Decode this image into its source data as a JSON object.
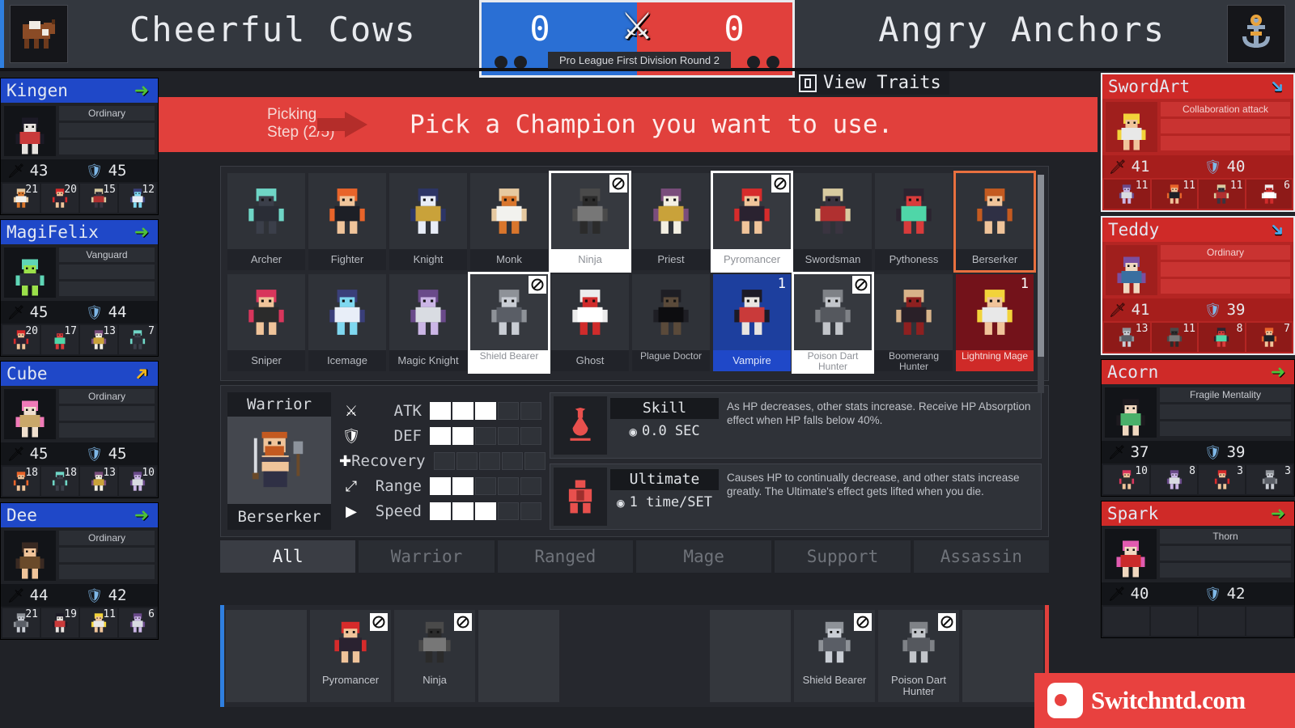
{
  "header": {
    "left_team": {
      "name": "Cheerful Cows",
      "logo_icon": "cow-logo",
      "score": "0",
      "dots": 2
    },
    "right_team": {
      "name": "Angry Anchors",
      "logo_icon": "anchor-logo",
      "score": "0",
      "dots": 2
    },
    "versus_icon": "crossed-swords-icon",
    "round_label": "Pro League First Division Round 2",
    "view_traits": {
      "key": "D",
      "label": "View Traits"
    }
  },
  "banner": {
    "step_line1": "Picking",
    "step_line2": "Step (2/5)",
    "message": "Pick a Champion you want to use.",
    "arrow_icon": "right-arrow-icon",
    "color": "#e1403c"
  },
  "left_players": [
    {
      "name": "Kingen",
      "ready_icon": "green-arrow-right",
      "trait": "Ordinary",
      "atk": "43",
      "def": "45",
      "portrait": "vampire-sprite",
      "picks": [
        {
          "count": "21",
          "icon": "monk-sprite"
        },
        {
          "count": "20",
          "icon": "pyromancer-sprite"
        },
        {
          "count": "15",
          "icon": "swordsman-sprite"
        },
        {
          "count": "12",
          "icon": "icemage-sprite"
        }
      ]
    },
    {
      "name": "MagiFelix",
      "ready_icon": "green-arrow-right",
      "trait": "Vanguard",
      "atk": "45",
      "def": "44",
      "portrait": "greenhair-sprite",
      "picks": [
        {
          "count": "20",
          "icon": "pyromancer-sprite"
        },
        {
          "count": "17",
          "icon": "pythoness-sprite"
        },
        {
          "count": "13",
          "icon": "priest-sprite"
        },
        {
          "count": "7",
          "icon": "archer-sprite"
        }
      ]
    },
    {
      "name": "Cube",
      "ready_icon": "yellow-arrow-upright",
      "trait": "Ordinary",
      "atk": "45",
      "def": "45",
      "portrait": "pinkhair-sprite",
      "picks": [
        {
          "count": "18",
          "icon": "fighter-sprite"
        },
        {
          "count": "18",
          "icon": "archer-sprite"
        },
        {
          "count": "13",
          "icon": "priest-sprite"
        },
        {
          "count": "10",
          "icon": "magicknight-sprite"
        }
      ]
    },
    {
      "name": "Dee",
      "ready_icon": "green-arrow-right",
      "trait": "Ordinary",
      "atk": "44",
      "def": "42",
      "portrait": "brownhair-sprite",
      "picks": [
        {
          "count": "21",
          "icon": "shieldbearer-sprite"
        },
        {
          "count": "19",
          "icon": "vampire-sprite"
        },
        {
          "count": "11",
          "icon": "lightningmage-sprite"
        },
        {
          "count": "6",
          "icon": "magicknight-sprite"
        }
      ]
    }
  ],
  "right_players": [
    {
      "name": "SwordArt",
      "ready_icon": "blue-arrow-downright",
      "trait": "Collaboration attack",
      "atk": "41",
      "def": "40",
      "portrait": "lightningmage-sprite",
      "selected": true,
      "picks": [
        {
          "count": "11",
          "icon": "magicknight-sprite"
        },
        {
          "count": "11",
          "icon": "fighter-sprite"
        },
        {
          "count": "11",
          "icon": "swordsman-sprite"
        },
        {
          "count": "6",
          "icon": "ghost-sprite"
        }
      ]
    },
    {
      "name": "Teddy",
      "ready_icon": "blue-arrow-downright",
      "trait": "Ordinary",
      "atk": "41",
      "def": "39",
      "portrait": "purplehair-sprite",
      "selected": true,
      "picks": [
        {
          "count": "13",
          "icon": "shieldbearer-sprite"
        },
        {
          "count": "11",
          "icon": "ninja-sprite"
        },
        {
          "count": "8",
          "icon": "pythoness-sprite"
        },
        {
          "count": "7",
          "icon": "fighter-sprite"
        }
      ]
    },
    {
      "name": "Acorn",
      "ready_icon": "green-arrow-right",
      "trait": "Fragile Mentality",
      "atk": "37",
      "def": "39",
      "portrait": "blackhair-sprite",
      "selected": false,
      "picks": [
        {
          "count": "10",
          "icon": "sniper-sprite"
        },
        {
          "count": "8",
          "icon": "magicknight-sprite"
        },
        {
          "count": "3",
          "icon": "pyromancer-sprite"
        },
        {
          "count": "3",
          "icon": "shieldbearer-sprite"
        }
      ]
    },
    {
      "name": "Spark",
      "ready_icon": "green-arrow-right",
      "trait": "Thorn",
      "atk": "40",
      "def": "42",
      "portrait": "sparkgirl-sprite",
      "selected": false,
      "picks": [
        {
          "count": "",
          "icon": ""
        },
        {
          "count": "",
          "icon": ""
        },
        {
          "count": "",
          "icon": ""
        },
        {
          "count": "",
          "icon": ""
        }
      ]
    }
  ],
  "champion_grid": {
    "row1": [
      {
        "name": "Archer",
        "state": "normal",
        "icon": "archer-sprite"
      },
      {
        "name": "Fighter",
        "state": "normal",
        "icon": "fighter-sprite"
      },
      {
        "name": "Knight",
        "state": "normal",
        "icon": "knight-sprite"
      },
      {
        "name": "Monk",
        "state": "normal",
        "icon": "monk-sprite"
      },
      {
        "name": "Ninja",
        "state": "banned",
        "icon": "ninja-sprite"
      },
      {
        "name": "Priest",
        "state": "normal",
        "icon": "priest-sprite"
      },
      {
        "name": "Pyromancer",
        "state": "banned",
        "icon": "pyromancer-sprite"
      },
      {
        "name": "Swordsman",
        "state": "normal",
        "icon": "swordsman-sprite"
      },
      {
        "name": "Pythoness",
        "state": "normal",
        "icon": "pythoness-sprite"
      },
      {
        "name": "Berserker",
        "state": "hovered",
        "icon": "berserker-sprite"
      }
    ],
    "row2": [
      {
        "name": "Sniper",
        "state": "normal",
        "icon": "sniper-sprite"
      },
      {
        "name": "Icemage",
        "state": "normal",
        "icon": "icemage-sprite"
      },
      {
        "name": "Magic Knight",
        "state": "normal",
        "icon": "magicknight-sprite"
      },
      {
        "name": "Shield Bearer",
        "state": "banned",
        "icon": "shieldbearer-sprite"
      },
      {
        "name": "Ghost",
        "state": "normal",
        "icon": "ghost-sprite"
      },
      {
        "name": "Plague Doctor",
        "state": "normal",
        "icon": "plaguedoctor-sprite"
      },
      {
        "name": "Vampire",
        "state": "picked-blue",
        "pick_number": "1",
        "icon": "vampire-sprite"
      },
      {
        "name": "Poison Dart Hunter",
        "state": "banned",
        "icon": "poisondart-sprite"
      },
      {
        "name": "Boomerang Hunter",
        "state": "normal",
        "icon": "boomerang-sprite"
      },
      {
        "name": "Lightning Mage",
        "state": "picked-red",
        "pick_number": "1",
        "icon": "lightningmage-sprite"
      }
    ]
  },
  "detail": {
    "role": "Warrior",
    "class_name": "Berserker",
    "portrait_icon": "berserker-sprite",
    "stats": [
      {
        "label": "ATK",
        "icon": "crossed-swords-icon",
        "value": 3,
        "max": 5
      },
      {
        "label": "DEF",
        "icon": "shield-icon",
        "value": 2,
        "max": 5
      },
      {
        "label": "Recovery",
        "icon": "plus-icon",
        "value": 0,
        "max": 5
      },
      {
        "label": "Range",
        "icon": "range-icon",
        "value": 2,
        "max": 5
      },
      {
        "label": "Speed",
        "icon": "boot-icon",
        "value": 3,
        "max": 5
      }
    ],
    "skill": {
      "tag": "Skill",
      "cooldown": "0.0 SEC",
      "clock_icon": "clock-icon",
      "icon": "blood-drop-icon",
      "description": "As HP decreases, other stats increase. Receive HP Absorption effect when HP falls below 40%."
    },
    "ultimate": {
      "tag": "Ultimate",
      "cooldown": "1 time/SET",
      "clock_icon": "clock-icon",
      "icon": "armored-body-icon",
      "description": "Causes HP to continually decrease, and other stats increase greatly. The Ultimate's effect gets lifted when you die."
    }
  },
  "filters": [
    {
      "label": "All",
      "active": true
    },
    {
      "label": "Warrior",
      "active": false
    },
    {
      "label": "Ranged",
      "active": false
    },
    {
      "label": "Mage",
      "active": false
    },
    {
      "label": "Support",
      "active": false
    },
    {
      "label": "Assassin",
      "active": false
    }
  ],
  "tray": {
    "blue_bans": [
      {
        "name": "",
        "icon": "",
        "empty": true
      },
      {
        "name": "Pyromancer",
        "icon": "pyromancer-sprite",
        "empty": false
      },
      {
        "name": "Ninja",
        "icon": "ninja-sprite",
        "empty": false
      },
      {
        "name": "",
        "icon": "",
        "empty": true
      }
    ],
    "red_bans": [
      {
        "name": "",
        "icon": "",
        "empty": true
      },
      {
        "name": "Shield Bearer",
        "icon": "shieldbearer-sprite",
        "empty": false
      },
      {
        "name": "Poison Dart Hunter",
        "icon": "poisondart-sprite",
        "empty": false
      },
      {
        "name": "",
        "icon": "",
        "empty": true
      }
    ]
  },
  "watermark": {
    "text": "Switchntd.com",
    "icon": "switch-logo-icon"
  }
}
